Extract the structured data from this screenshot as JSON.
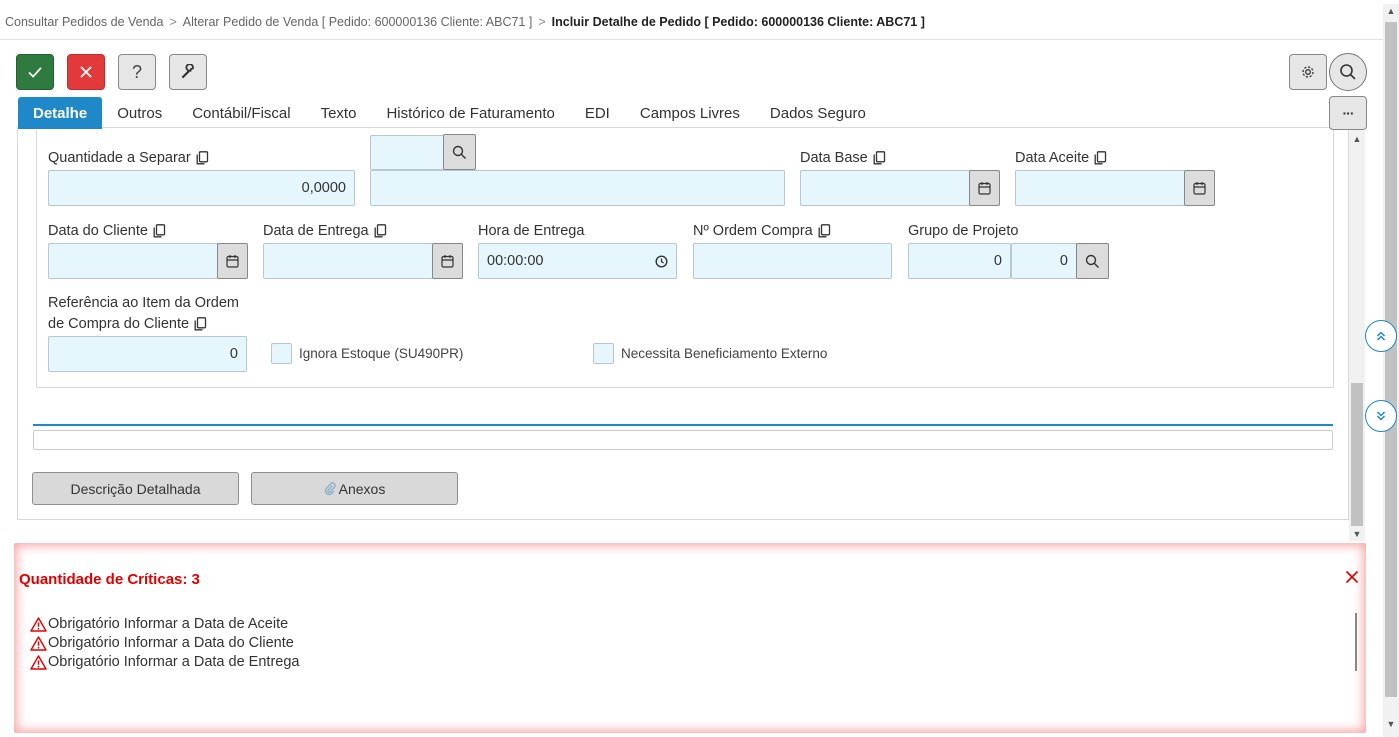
{
  "breadcrumb": {
    "items": [
      "Consultar Pedidos de Venda",
      "Alterar Pedido de Venda [ Pedido: 600000136 Cliente: ABC71 ]"
    ],
    "current": "Incluir Detalhe de Pedido [ Pedido: 600000136 Cliente: ABC71 ]",
    "separator": ">"
  },
  "toolbar": {
    "confirm_icon": "check-icon",
    "cancel_icon": "close-icon",
    "help_label": "?",
    "tools_icon": "wrench-icon",
    "settings_icon": "gear-icon",
    "search_icon": "search-icon"
  },
  "tabs": [
    {
      "label": "Detalhe",
      "active": true
    },
    {
      "label": "Outros"
    },
    {
      "label": "Contábil/Fiscal"
    },
    {
      "label": "Texto"
    },
    {
      "label": "Histórico de Faturamento"
    },
    {
      "label": "EDI"
    },
    {
      "label": "Campos Livres"
    },
    {
      "label": "Dados Seguro"
    }
  ],
  "tabs_more_label": "···",
  "form": {
    "qtd_separar": {
      "label": "Quantidade a Separar",
      "value": "0,0000"
    },
    "data_base": {
      "label": "Data Base",
      "value": ""
    },
    "data_aceite": {
      "label": "Data Aceite",
      "value": ""
    },
    "data_cliente": {
      "label": "Data do Cliente",
      "value": ""
    },
    "data_entrega": {
      "label": "Data de Entrega",
      "value": ""
    },
    "hora_entrega": {
      "label": "Hora de Entrega",
      "value": "00:00:00"
    },
    "ordem_compra": {
      "label": "Nº Ordem Compra",
      "value": ""
    },
    "grupo_projeto": {
      "label": "Grupo de Projeto",
      "value1": "0",
      "value2": "0"
    },
    "ref_item": {
      "label_line1": "Referência ao Item da Ordem",
      "label_line2": "de Compra do Cliente",
      "value": "0"
    },
    "ignora_estoque": {
      "label": "Ignora Estoque (SU490PR)",
      "checked": false
    },
    "benef_externo": {
      "label": "Necessita Beneficiamento Externo",
      "checked": false
    }
  },
  "buttons": {
    "descricao": "Descrição Detalhada",
    "anexos": "Anexos"
  },
  "criticas": {
    "title": "Quantidade de Críticas: 3",
    "items": [
      "Obrigatório Informar a Data de Aceite",
      "Obrigatório Informar a Data do Cliente",
      "Obrigatório Informar a Data de Entrega"
    ]
  },
  "colors": {
    "accent": "#1e88c9",
    "confirm": "#2f7a3e",
    "cancel": "#e23a3a",
    "error": "#e00000",
    "input_bg": "#e6f6fd"
  }
}
